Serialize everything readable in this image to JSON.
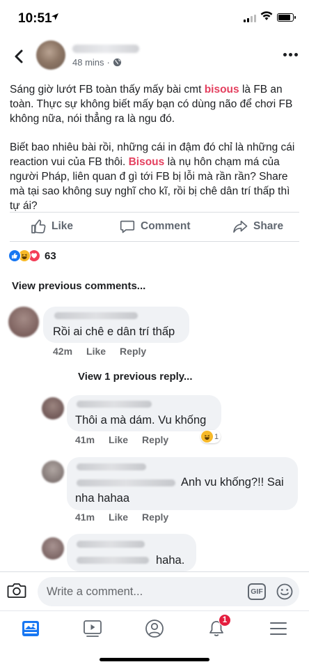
{
  "status_bar": {
    "time": "10:51",
    "battery_level": 0.9
  },
  "post": {
    "time_ago": "48 mins",
    "dot": "·",
    "paragraph1": [
      {
        "text": "Sáng giờ lướt FB toàn thấy mấy bài cmt ",
        "hl": false
      },
      {
        "text": "bisous",
        "hl": true
      },
      {
        "text": " là FB an toàn. Thực sự không biết mấy bạn có dùng não để chơi FB không nữa, nói thẳng ra là ngu đó.",
        "hl": false
      }
    ],
    "paragraph2": [
      {
        "text": "Biết bao nhiêu bài rồi, những cái in đậm đó chỉ là những cái reaction vui của FB thôi. ",
        "hl": false
      },
      {
        "text": "Bisous",
        "hl": true
      },
      {
        "text": " là nụ hôn chạm má của người Pháp, liên quan đ gì tới FB bị lỗi mà rần rần? Share mà tại sao không suy nghĩ cho kĩ, rồi bị chê dân trí thấp thì tự ái?",
        "hl": false
      }
    ],
    "actions": {
      "like": "Like",
      "comment": "Comment",
      "share": "Share"
    },
    "reaction_count": "63",
    "colors": {
      "highlight": "#e4405f",
      "like": "#1877f2",
      "haha": "#f7b928",
      "love": "#f33e58"
    }
  },
  "comments_section": {
    "view_previous": "View previous comments...",
    "view_reply": "View 1 previous reply...",
    "comments": [
      {
        "text": "Rồi ai chê e dân trí thấp",
        "time": "42m",
        "like": "Like",
        "reply": "Reply"
      },
      {
        "text": "Thôi a mà dám. Vu khống",
        "time": "41m",
        "like": "Like",
        "reply": "Reply",
        "reaction_count": "1"
      },
      {
        "text": "Anh vu khống?!! Sai",
        "text2": "nha hahaa",
        "time": "41m",
        "like": "Like",
        "reply": "Reply"
      },
      {
        "text": "haha."
      }
    ]
  },
  "composer": {
    "placeholder": "Write a comment...",
    "gif": "GIF"
  },
  "tabbar": {
    "notification_badge": "1",
    "icons": [
      "news-feed-icon",
      "watch-icon",
      "profile-icon",
      "bell-icon",
      "menu-icon"
    ]
  }
}
